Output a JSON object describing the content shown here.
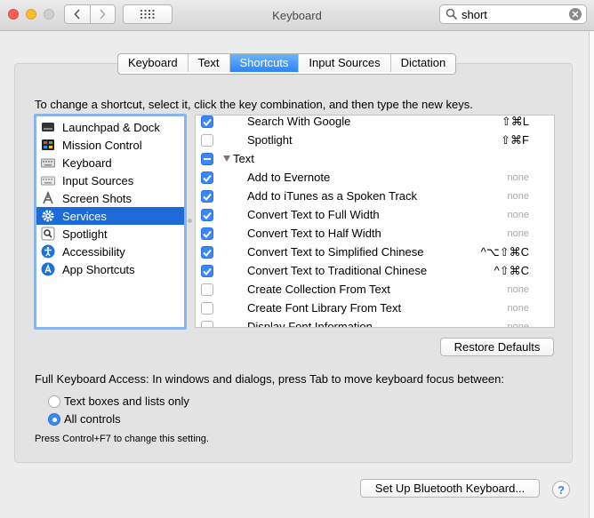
{
  "window": {
    "title": "Keyboard"
  },
  "search": {
    "value": "short"
  },
  "tabs": [
    {
      "label": "Keyboard",
      "active": false
    },
    {
      "label": "Text",
      "active": false
    },
    {
      "label": "Shortcuts",
      "active": true
    },
    {
      "label": "Input Sources",
      "active": false
    },
    {
      "label": "Dictation",
      "active": false
    }
  ],
  "hint": "To change a shortcut, select it, click the key combination, and then type the new keys.",
  "categories": [
    {
      "label": "Launchpad & Dock",
      "icon": "launchpad-icon"
    },
    {
      "label": "Mission Control",
      "icon": "mission-control-icon"
    },
    {
      "label": "Keyboard",
      "icon": "keyboard-icon"
    },
    {
      "label": "Input Sources",
      "icon": "input-sources-icon"
    },
    {
      "label": "Screen Shots",
      "icon": "screenshot-icon"
    },
    {
      "label": "Services",
      "icon": "gear-icon",
      "selected": true
    },
    {
      "label": "Spotlight",
      "icon": "spotlight-icon"
    },
    {
      "label": "Accessibility",
      "icon": "accessibility-icon"
    },
    {
      "label": "App Shortcuts",
      "icon": "app-shortcuts-icon"
    }
  ],
  "shortcuts": [
    {
      "label": "Search With Google",
      "checked": true,
      "key": "⇧⌘L"
    },
    {
      "label": "Spotlight",
      "checked": false,
      "key": "⇧⌘F"
    },
    {
      "label": "Text",
      "group": true,
      "checked": "mixed",
      "key": ""
    },
    {
      "label": "Add to Evernote",
      "checked": true,
      "key": "none"
    },
    {
      "label": "Add to iTunes as a Spoken Track",
      "checked": true,
      "key": "none"
    },
    {
      "label": "Convert Text to Full Width",
      "checked": true,
      "key": "none"
    },
    {
      "label": "Convert Text to Half Width",
      "checked": true,
      "key": "none"
    },
    {
      "label": "Convert Text to Simplified Chinese",
      "checked": true,
      "key": "^⌥⇧⌘C"
    },
    {
      "label": "Convert Text to Traditional Chinese",
      "checked": true,
      "key": "^⇧⌘C"
    },
    {
      "label": "Create Collection From Text",
      "checked": false,
      "key": "none"
    },
    {
      "label": "Create Font Library From Text",
      "checked": false,
      "key": "none"
    },
    {
      "label": "Display Font Information",
      "checked": false,
      "key": "none"
    }
  ],
  "buttons": {
    "restore_defaults": "Restore Defaults",
    "bluetooth": "Set Up Bluetooth Keyboard...",
    "help": "?"
  },
  "full_keyboard_access": {
    "label": "Full Keyboard Access: In windows and dialogs, press Tab to move keyboard focus between:",
    "options": [
      {
        "label": "Text boxes and lists only",
        "selected": false
      },
      {
        "label": "All controls",
        "selected": true
      }
    ],
    "note": "Press Control+F7 to change this setting."
  },
  "colors": {
    "accent": "#2c84f7",
    "selection": "#1f6ad9",
    "focus_ring": "#8ab4ef"
  }
}
